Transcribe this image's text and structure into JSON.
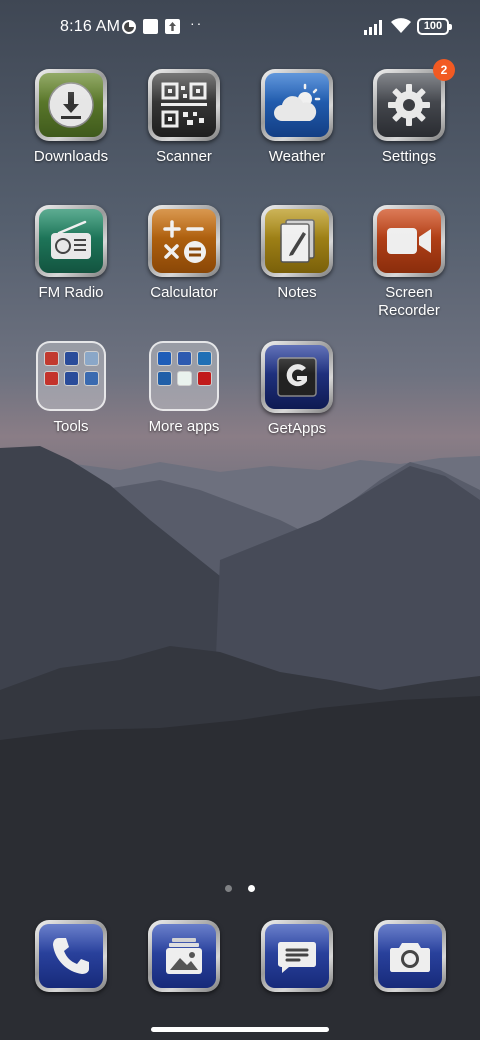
{
  "status_bar": {
    "time": "8:16 AM",
    "battery": "100",
    "icons": [
      "notification-app-icon",
      "notification-square-icon",
      "notification-upload-icon",
      "more-dots-icon",
      "signal-icon",
      "wifi-icon",
      "battery-icon"
    ]
  },
  "apps": [
    {
      "label": "Downloads",
      "icon": "download-icon"
    },
    {
      "label": "Scanner",
      "icon": "qr-code-icon"
    },
    {
      "label": "Weather",
      "icon": "cloud-sun-icon"
    },
    {
      "label": "Settings",
      "icon": "gear-icon",
      "badge": "2"
    },
    {
      "label": "FM Radio",
      "icon": "radio-icon"
    },
    {
      "label": "Calculator",
      "icon": "calculator-icon"
    },
    {
      "label": "Notes",
      "icon": "notes-icon"
    },
    {
      "label": "Screen\nRecorder",
      "icon": "video-camera-icon"
    },
    {
      "label": "Tools",
      "icon": "folder-icon"
    },
    {
      "label": "More apps",
      "icon": "folder-icon"
    },
    {
      "label": "GetApps",
      "icon": "getapps-g-icon"
    }
  ],
  "page_indicator": {
    "pages": 2,
    "current": 2
  },
  "dock": [
    {
      "icon": "phone-icon"
    },
    {
      "icon": "gallery-icon"
    },
    {
      "icon": "messages-icon"
    },
    {
      "icon": "camera-icon"
    }
  ],
  "colors": {
    "badge": "#f25a22",
    "downloads_bg": "#5c7a2c",
    "weather_bg": "#1e5aa8",
    "fm_radio_bg": "#1f7a5c",
    "calculator_bg": "#b8620f",
    "notes_bg": "#a88a17",
    "recorder_bg": "#b8421a",
    "getapps_bg": "#1c2d74",
    "dock_bg": "#2a3f9a"
  }
}
